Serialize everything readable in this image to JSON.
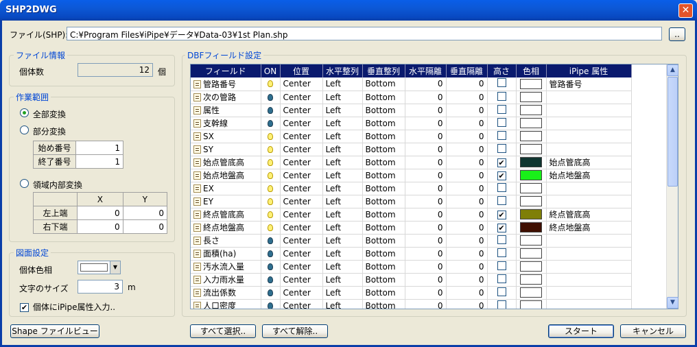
{
  "window": {
    "title": "SHP2DWG",
    "close": "✕"
  },
  "file": {
    "label": "ファイル(SHP):",
    "path": "C:¥Program Files¥iPipe¥データ¥Data-03¥1st Plan.shp",
    "browse": ".."
  },
  "file_info": {
    "title": "ファイル情報",
    "count_label": "個体数",
    "count_value": "12",
    "count_unit": "個"
  },
  "work_range": {
    "title": "作業範囲",
    "all": "全部変換",
    "partial": "部分変換",
    "start_label": "始め番号",
    "start_value": "1",
    "end_label": "終了番号",
    "end_value": "1",
    "region": "領域内部変換",
    "x_header": "X",
    "y_header": "Y",
    "upper_left": "左上端",
    "ul_x": "0",
    "ul_y": "0",
    "lower_right": "右下端",
    "lr_x": "0",
    "lr_y": "0"
  },
  "drawing": {
    "title": "図面設定",
    "color_label": "個体色相",
    "text_size_label": "文字のサイズ",
    "text_size_value": "3",
    "text_size_unit": "m",
    "attr_check": "個体にiPipe属性入力.."
  },
  "dbf": {
    "title": "DBFフィールド設定",
    "headers": [
      "フィールド",
      "ON",
      "位置",
      "水平整列",
      "垂直整列",
      "水平隔離",
      "垂直隔離",
      "高さ",
      "色相",
      "iPipe 属性"
    ],
    "rows": [
      {
        "field": "管路番号",
        "on": true,
        "pos": "Center",
        "h": "Left",
        "v": "Bottom",
        "hs": "0",
        "vs": "0",
        "height": false,
        "color": "#ffffff",
        "attr": "管路番号"
      },
      {
        "field": "次の管路",
        "on": false,
        "pos": "Center",
        "h": "Left",
        "v": "Bottom",
        "hs": "0",
        "vs": "0",
        "height": false,
        "color": "#ffffff",
        "attr": ""
      },
      {
        "field": "属性",
        "on": false,
        "pos": "Center",
        "h": "Left",
        "v": "Bottom",
        "hs": "0",
        "vs": "0",
        "height": false,
        "color": "#ffffff",
        "attr": ""
      },
      {
        "field": "支幹線",
        "on": false,
        "pos": "Center",
        "h": "Left",
        "v": "Bottom",
        "hs": "0",
        "vs": "0",
        "height": false,
        "color": "#ffffff",
        "attr": ""
      },
      {
        "field": "SX",
        "on": true,
        "pos": "Center",
        "h": "Left",
        "v": "Bottom",
        "hs": "0",
        "vs": "0",
        "height": false,
        "color": "#ffffff",
        "attr": ""
      },
      {
        "field": "SY",
        "on": true,
        "pos": "Center",
        "h": "Left",
        "v": "Bottom",
        "hs": "0",
        "vs": "0",
        "height": false,
        "color": "#ffffff",
        "attr": ""
      },
      {
        "field": "始点管底高",
        "on": true,
        "pos": "Center",
        "h": "Left",
        "v": "Bottom",
        "hs": "0",
        "vs": "0",
        "height": true,
        "color": "#0f3530",
        "attr": "始点管底高"
      },
      {
        "field": "始点地盤高",
        "on": true,
        "pos": "Center",
        "h": "Left",
        "v": "Bottom",
        "hs": "0",
        "vs": "0",
        "height": true,
        "color": "#19f019",
        "attr": "始点地盤高"
      },
      {
        "field": "EX",
        "on": true,
        "pos": "Center",
        "h": "Left",
        "v": "Bottom",
        "hs": "0",
        "vs": "0",
        "height": false,
        "color": "#ffffff",
        "attr": ""
      },
      {
        "field": "EY",
        "on": true,
        "pos": "Center",
        "h": "Left",
        "v": "Bottom",
        "hs": "0",
        "vs": "0",
        "height": false,
        "color": "#ffffff",
        "attr": ""
      },
      {
        "field": "終点管底高",
        "on": true,
        "pos": "Center",
        "h": "Left",
        "v": "Bottom",
        "hs": "0",
        "vs": "0",
        "height": true,
        "color": "#7f7f08",
        "attr": "終点管底高"
      },
      {
        "field": "終点地盤高",
        "on": true,
        "pos": "Center",
        "h": "Left",
        "v": "Bottom",
        "hs": "0",
        "vs": "0",
        "height": true,
        "color": "#3f0f00",
        "attr": "終点地盤高"
      },
      {
        "field": "長さ",
        "on": false,
        "pos": "Center",
        "h": "Left",
        "v": "Bottom",
        "hs": "0",
        "vs": "0",
        "height": false,
        "color": "#ffffff",
        "attr": ""
      },
      {
        "field": "面積(ha)",
        "on": false,
        "pos": "Center",
        "h": "Left",
        "v": "Bottom",
        "hs": "0",
        "vs": "0",
        "height": false,
        "color": "#ffffff",
        "attr": ""
      },
      {
        "field": "汚水流入量",
        "on": false,
        "pos": "Center",
        "h": "Left",
        "v": "Bottom",
        "hs": "0",
        "vs": "0",
        "height": false,
        "color": "#ffffff",
        "attr": ""
      },
      {
        "field": "入力雨水量",
        "on": false,
        "pos": "Center",
        "h": "Left",
        "v": "Bottom",
        "hs": "0",
        "vs": "0",
        "height": false,
        "color": "#ffffff",
        "attr": ""
      },
      {
        "field": "流出係数",
        "on": false,
        "pos": "Center",
        "h": "Left",
        "v": "Bottom",
        "hs": "0",
        "vs": "0",
        "height": false,
        "color": "#ffffff",
        "attr": ""
      },
      {
        "field": "人口密度",
        "on": false,
        "pos": "Center",
        "h": "Left",
        "v": "Bottom",
        "hs": "0",
        "vs": "0",
        "height": false,
        "color": "#ffffff",
        "attr": ""
      }
    ]
  },
  "buttons": {
    "shape_viewer": "Shape ファイルビュー",
    "select_all": "すべて選択..",
    "deselect_all": "すべて解除..",
    "start": "スタート",
    "cancel": "キャンセル"
  }
}
